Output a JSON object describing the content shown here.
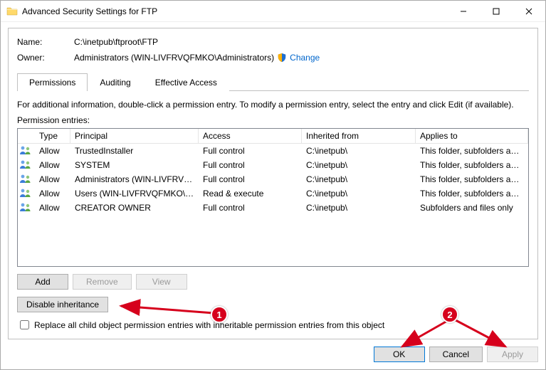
{
  "window": {
    "title": "Advanced Security Settings for FTP"
  },
  "form": {
    "name_label": "Name:",
    "name_value": "C:\\inetpub\\ftproot\\FTP",
    "owner_label": "Owner:",
    "owner_value": "Administrators (WIN-LIVFRVQFMKO\\Administrators)",
    "change_link": "Change"
  },
  "tabs": {
    "permissions": "Permissions",
    "auditing": "Auditing",
    "effective": "Effective Access"
  },
  "info_text": "For additional information, double-click a permission entry. To modify a permission entry, select the entry and click Edit (if available).",
  "entries_label": "Permission entries:",
  "columns": {
    "type": "Type",
    "principal": "Principal",
    "access": "Access",
    "inherited": "Inherited from",
    "applies": "Applies to"
  },
  "rows": [
    {
      "type": "Allow",
      "principal": "TrustedInstaller",
      "access": "Full control",
      "inherited": "C:\\inetpub\\",
      "applies": "This folder, subfolders and files"
    },
    {
      "type": "Allow",
      "principal": "SYSTEM",
      "access": "Full control",
      "inherited": "C:\\inetpub\\",
      "applies": "This folder, subfolders and files"
    },
    {
      "type": "Allow",
      "principal": "Administrators (WIN-LIVFRVQ...",
      "access": "Full control",
      "inherited": "C:\\inetpub\\",
      "applies": "This folder, subfolders and files"
    },
    {
      "type": "Allow",
      "principal": "Users (WIN-LIVFRVQFMKO\\Us...",
      "access": "Read & execute",
      "inherited": "C:\\inetpub\\",
      "applies": "This folder, subfolders and files"
    },
    {
      "type": "Allow",
      "principal": "CREATOR OWNER",
      "access": "Full control",
      "inherited": "C:\\inetpub\\",
      "applies": "Subfolders and files only"
    }
  ],
  "buttons": {
    "add": "Add",
    "remove": "Remove",
    "view": "View",
    "disable_inh": "Disable inheritance",
    "replace_check": "Replace all child object permission entries with inheritable permission entries from this object",
    "ok": "OK",
    "cancel": "Cancel",
    "apply": "Apply"
  },
  "annotations": {
    "marker1": "1",
    "marker2": "2"
  }
}
